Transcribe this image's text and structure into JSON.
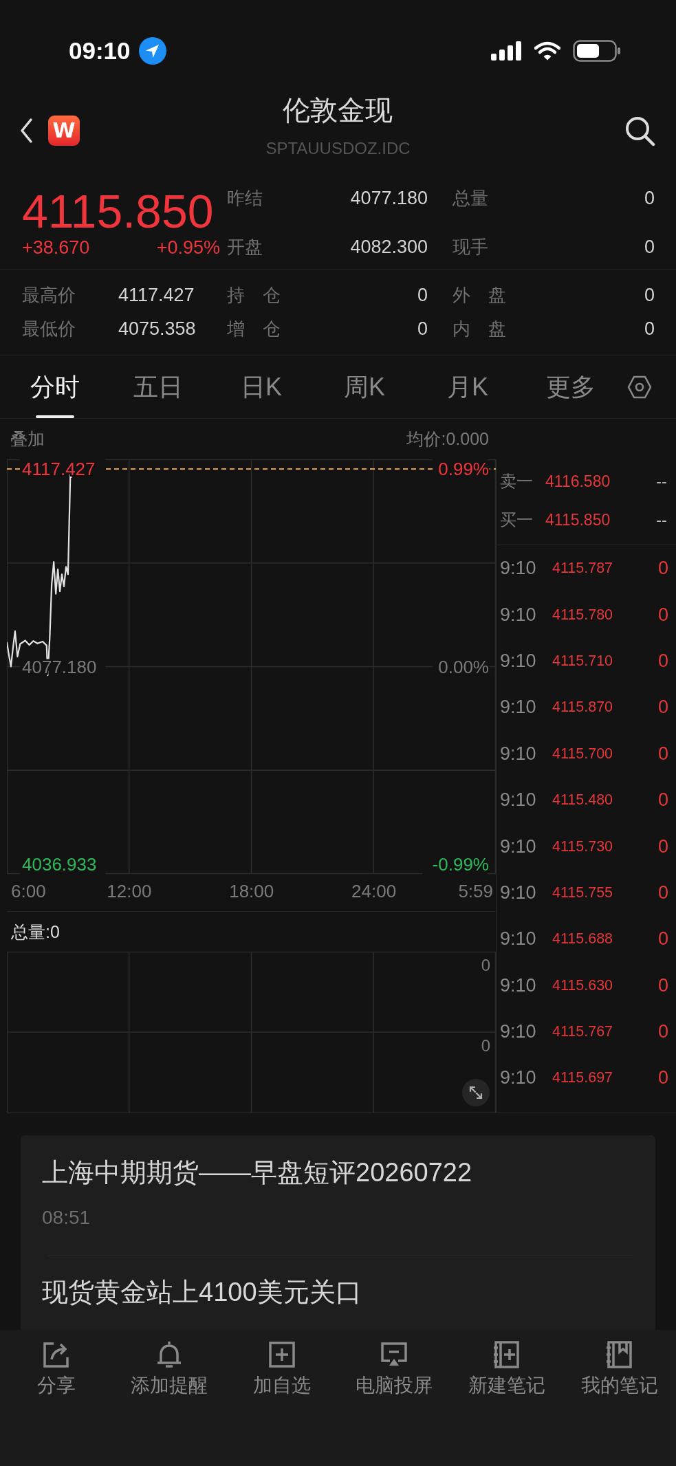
{
  "status_bar": {
    "time": "09:10"
  },
  "header": {
    "logo_letter": "W",
    "title": "伦敦金现",
    "symbol": "SPTAUUSDOZ.IDC"
  },
  "quote": {
    "rising": true,
    "price": "4115.850",
    "change": "+38.670",
    "change_percent": "+0.95%",
    "summary": [
      {
        "label": "昨结",
        "value": "4077.180"
      },
      {
        "label": "总量",
        "value": "0"
      },
      {
        "label": "开盘",
        "value": "4082.300"
      },
      {
        "label": "现手",
        "value": "0"
      }
    ],
    "details": [
      {
        "label": "最高价",
        "value": "4117.427"
      },
      {
        "label": "持　仓",
        "value": "0"
      },
      {
        "label": "外　盘",
        "value": "0"
      },
      {
        "label": "最低价",
        "value": "4075.358"
      },
      {
        "label": "增　仓",
        "value": "0"
      },
      {
        "label": "内　盘",
        "value": "0"
      }
    ]
  },
  "tabs": [
    {
      "label": "分时",
      "selected": true
    },
    {
      "label": "五日",
      "selected": false
    },
    {
      "label": "日K",
      "selected": false
    },
    {
      "label": "周K",
      "selected": false
    },
    {
      "label": "月K",
      "selected": false
    },
    {
      "label": "更多",
      "selected": false
    }
  ],
  "chart_panel": {
    "overlay": "叠加",
    "average_price": "均价:0.000",
    "right_axis_labels": [
      "0.99%",
      "0.00%",
      "-0.99%"
    ],
    "axis_end_label": "5:59",
    "chart_data": {
      "type": "line",
      "x": [
        6.0,
        6.1,
        6.2,
        6.3,
        6.4,
        6.52,
        6.65,
        6.9,
        7.1,
        7.3,
        7.5,
        7.75,
        7.95,
        8.0,
        8.1,
        8.2,
        8.3,
        8.4,
        8.5,
        8.6,
        8.7,
        8.8,
        8.9,
        9.0,
        9.05,
        9.12,
        9.17
      ],
      "values": [
        4082.1,
        4079.5,
        4077.2,
        4081.0,
        4084.4,
        4079.2,
        4081.8,
        4082.5,
        4081.6,
        4082.4,
        4081.9,
        4082.3,
        4081.5,
        4075.4,
        4083.0,
        4094.0,
        4098.5,
        4092.0,
        4097.0,
        4092.5,
        4096.0,
        4093.5,
        4097.5,
        4096.0,
        4105.0,
        4117.4,
        4115.8
      ],
      "xlim": [
        6,
        29.983
      ],
      "ylim": [
        4034.97,
        4119.39
      ],
      "grid": true,
      "xticks": [
        {
          "value": 6,
          "label": "6:00"
        },
        {
          "value": 12,
          "label": "12:00"
        },
        {
          "value": 18,
          "label": "18:00"
        },
        {
          "value": 24,
          "label": "24:00"
        }
      ],
      "yticks": [
        {
          "value": 4036.933,
          "label": "4036.933"
        },
        {
          "value": 4077.18,
          "label": "4077.180"
        },
        {
          "value": 4117.427,
          "label": "4117.427"
        }
      ],
      "ref_lines": [
        {
          "axis": "y",
          "value": 4117.427
        }
      ]
    }
  },
  "order_book": [
    {
      "label": "卖一",
      "price": "4116.580",
      "volume": "--"
    },
    {
      "label": "买一",
      "price": "4115.850",
      "volume": "--"
    }
  ],
  "trades": [
    {
      "time": "9:10",
      "price": "4115.787",
      "volume": "0"
    },
    {
      "time": "9:10",
      "price": "4115.780",
      "volume": "0"
    },
    {
      "time": "9:10",
      "price": "4115.710",
      "volume": "0"
    },
    {
      "time": "9:10",
      "price": "4115.870",
      "volume": "0"
    },
    {
      "time": "9:10",
      "price": "4115.700",
      "volume": "0"
    },
    {
      "time": "9:10",
      "price": "4115.480",
      "volume": "0"
    },
    {
      "time": "9:10",
      "price": "4115.730",
      "volume": "0"
    },
    {
      "time": "9:10",
      "price": "4115.755",
      "volume": "0"
    },
    {
      "time": "9:10",
      "price": "4115.688",
      "volume": "0"
    },
    {
      "time": "9:10",
      "price": "4115.630",
      "volume": "0"
    },
    {
      "time": "9:10",
      "price": "4115.767",
      "volume": "0"
    },
    {
      "time": "9:10",
      "price": "4115.697",
      "volume": "0"
    }
  ],
  "volume_panel": {
    "total": "总量:0",
    "axis_labels": [
      "0",
      "0"
    ]
  },
  "news": [
    {
      "title": "上海中期期货——早盘短评20260722",
      "time": "08:51"
    },
    {
      "title": "现货黄金站上4100美元关口"
    }
  ],
  "toolbar": [
    "分享",
    "添加提醒",
    "加自选",
    "电脑投屏",
    "新建笔记",
    "我的笔记"
  ]
}
